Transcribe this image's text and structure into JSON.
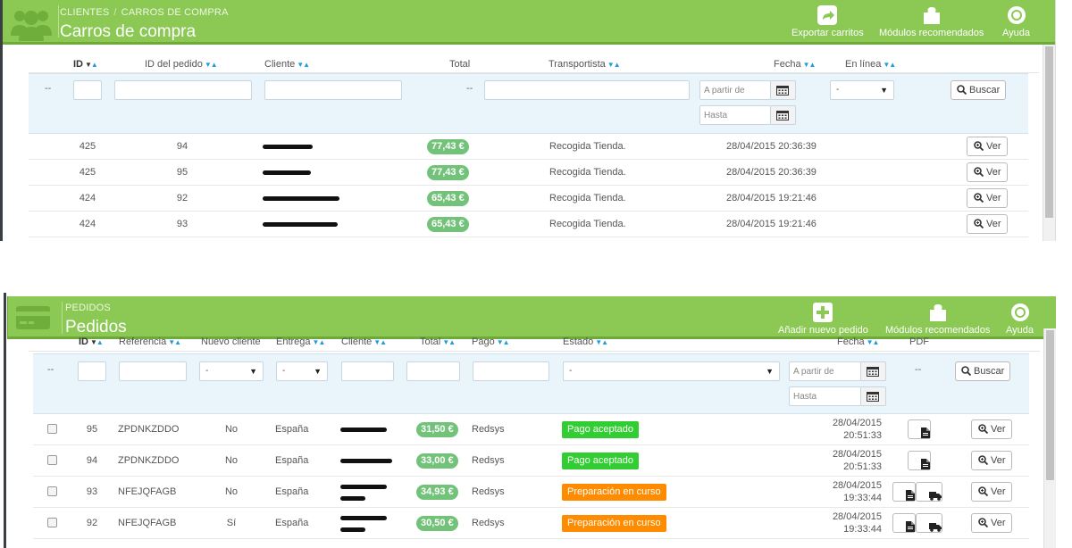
{
  "carts": {
    "breadcrumb": [
      "CLIENTES",
      "CARROS DE COMPRA"
    ],
    "title": "Carros de compra",
    "toolbar": {
      "export": "Exportar carritos",
      "modules": "Módulos recomendados",
      "help": "Ayuda"
    },
    "columns": {
      "id": "ID",
      "order_id": "ID del pedido",
      "customer": "Cliente",
      "total": "Total",
      "carrier": "Transportista",
      "date": "Fecha",
      "online": "En línea"
    },
    "filters": {
      "dash": "--",
      "total_dash": "--",
      "date_from": "A partir de",
      "date_to": "Hasta",
      "online_select": "-",
      "search": "Buscar"
    },
    "rows": [
      {
        "id": "425",
        "order": "94",
        "total": "77,43 €",
        "carrier": "Recogida Tienda.",
        "date": "28/04/2015 20:36:39",
        "view": "Ver"
      },
      {
        "id": "425",
        "order": "95",
        "total": "77,43 €",
        "carrier": "Recogida Tienda.",
        "date": "28/04/2015 20:36:39",
        "view": "Ver"
      },
      {
        "id": "424",
        "order": "92",
        "total": "65,43 €",
        "carrier": "Recogida Tienda.",
        "date": "28/04/2015 19:21:46",
        "view": "Ver"
      },
      {
        "id": "424",
        "order": "93",
        "total": "65,43 €",
        "carrier": "Recogida Tienda.",
        "date": "28/04/2015 19:21:46",
        "view": "Ver"
      }
    ]
  },
  "orders": {
    "breadcrumb": [
      "PEDIDOS"
    ],
    "title": "Pedidos",
    "toolbar": {
      "add": "Añadir nuevo pedido",
      "modules": "Módulos recomendados",
      "help": "Ayuda"
    },
    "columns": {
      "id": "ID",
      "reference": "Referencia",
      "new_client": "Nuevo cliente",
      "delivery": "Entrega",
      "customer": "Cliente",
      "total": "Total",
      "payment": "Pago",
      "status": "Estado",
      "date": "Fecha",
      "pdf": "PDF"
    },
    "filters": {
      "dash": "--",
      "new_client_select": "-",
      "delivery_select": "-",
      "status_select": "-",
      "date_from": "A partir de",
      "date_to": "Hasta",
      "pdf_dash": "--",
      "search": "Buscar"
    },
    "rows": [
      {
        "id": "95",
        "ref": "ZPDNKZDDO",
        "new": "No",
        "country": "España",
        "total": "31,50 €",
        "payment": "Redsys",
        "status": "Pago aceptado",
        "status_color": "#32cd32",
        "date": "28/04/2015",
        "time": "20:51:33",
        "view": "Ver"
      },
      {
        "id": "94",
        "ref": "ZPDNKZDDO",
        "new": "No",
        "country": "España",
        "total": "33,00 €",
        "payment": "Redsys",
        "status": "Pago aceptado",
        "status_color": "#32cd32",
        "date": "28/04/2015",
        "time": "20:51:33",
        "view": "Ver"
      },
      {
        "id": "93",
        "ref": "NFEJQFAGB",
        "new": "No",
        "country": "España",
        "total": "34,93 €",
        "payment": "Redsys",
        "status": "Preparación en curso",
        "status_color": "#ff8c00",
        "date": "28/04/2015",
        "time": "19:33:44",
        "view": "Ver"
      },
      {
        "id": "92",
        "ref": "NFEJQFAGB",
        "new": "Sí",
        "country": "España",
        "total": "30,50 €",
        "payment": "Redsys",
        "status": "Preparación en curso",
        "status_color": "#ff8c00",
        "date": "28/04/2015",
        "time": "19:33:44",
        "view": "Ver"
      }
    ]
  },
  "colors": {
    "header_green": "#8bc954",
    "price_badge": "#72c279",
    "status_green": "#32cd32",
    "status_orange": "#ff8c00",
    "filter_bg": "#eaf4fb",
    "sort_arrow": "#1f9fd8"
  }
}
